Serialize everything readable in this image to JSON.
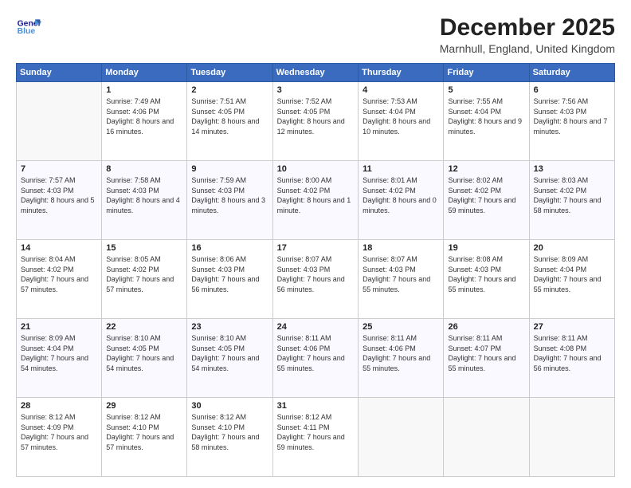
{
  "logo": {
    "line1": "General",
    "line2": "Blue"
  },
  "title": "December 2025",
  "subtitle": "Marnhull, England, United Kingdom",
  "days_header": [
    "Sunday",
    "Monday",
    "Tuesday",
    "Wednesday",
    "Thursday",
    "Friday",
    "Saturday"
  ],
  "weeks": [
    [
      {
        "num": "",
        "sunrise": "",
        "sunset": "",
        "daylight": ""
      },
      {
        "num": "1",
        "sunrise": "Sunrise: 7:49 AM",
        "sunset": "Sunset: 4:06 PM",
        "daylight": "Daylight: 8 hours and 16 minutes."
      },
      {
        "num": "2",
        "sunrise": "Sunrise: 7:51 AM",
        "sunset": "Sunset: 4:05 PM",
        "daylight": "Daylight: 8 hours and 14 minutes."
      },
      {
        "num": "3",
        "sunrise": "Sunrise: 7:52 AM",
        "sunset": "Sunset: 4:05 PM",
        "daylight": "Daylight: 8 hours and 12 minutes."
      },
      {
        "num": "4",
        "sunrise": "Sunrise: 7:53 AM",
        "sunset": "Sunset: 4:04 PM",
        "daylight": "Daylight: 8 hours and 10 minutes."
      },
      {
        "num": "5",
        "sunrise": "Sunrise: 7:55 AM",
        "sunset": "Sunset: 4:04 PM",
        "daylight": "Daylight: 8 hours and 9 minutes."
      },
      {
        "num": "6",
        "sunrise": "Sunrise: 7:56 AM",
        "sunset": "Sunset: 4:03 PM",
        "daylight": "Daylight: 8 hours and 7 minutes."
      }
    ],
    [
      {
        "num": "7",
        "sunrise": "Sunrise: 7:57 AM",
        "sunset": "Sunset: 4:03 PM",
        "daylight": "Daylight: 8 hours and 5 minutes."
      },
      {
        "num": "8",
        "sunrise": "Sunrise: 7:58 AM",
        "sunset": "Sunset: 4:03 PM",
        "daylight": "Daylight: 8 hours and 4 minutes."
      },
      {
        "num": "9",
        "sunrise": "Sunrise: 7:59 AM",
        "sunset": "Sunset: 4:03 PM",
        "daylight": "Daylight: 8 hours and 3 minutes."
      },
      {
        "num": "10",
        "sunrise": "Sunrise: 8:00 AM",
        "sunset": "Sunset: 4:02 PM",
        "daylight": "Daylight: 8 hours and 1 minute."
      },
      {
        "num": "11",
        "sunrise": "Sunrise: 8:01 AM",
        "sunset": "Sunset: 4:02 PM",
        "daylight": "Daylight: 8 hours and 0 minutes."
      },
      {
        "num": "12",
        "sunrise": "Sunrise: 8:02 AM",
        "sunset": "Sunset: 4:02 PM",
        "daylight": "Daylight: 7 hours and 59 minutes."
      },
      {
        "num": "13",
        "sunrise": "Sunrise: 8:03 AM",
        "sunset": "Sunset: 4:02 PM",
        "daylight": "Daylight: 7 hours and 58 minutes."
      }
    ],
    [
      {
        "num": "14",
        "sunrise": "Sunrise: 8:04 AM",
        "sunset": "Sunset: 4:02 PM",
        "daylight": "Daylight: 7 hours and 57 minutes."
      },
      {
        "num": "15",
        "sunrise": "Sunrise: 8:05 AM",
        "sunset": "Sunset: 4:02 PM",
        "daylight": "Daylight: 7 hours and 57 minutes."
      },
      {
        "num": "16",
        "sunrise": "Sunrise: 8:06 AM",
        "sunset": "Sunset: 4:03 PM",
        "daylight": "Daylight: 7 hours and 56 minutes."
      },
      {
        "num": "17",
        "sunrise": "Sunrise: 8:07 AM",
        "sunset": "Sunset: 4:03 PM",
        "daylight": "Daylight: 7 hours and 56 minutes."
      },
      {
        "num": "18",
        "sunrise": "Sunrise: 8:07 AM",
        "sunset": "Sunset: 4:03 PM",
        "daylight": "Daylight: 7 hours and 55 minutes."
      },
      {
        "num": "19",
        "sunrise": "Sunrise: 8:08 AM",
        "sunset": "Sunset: 4:03 PM",
        "daylight": "Daylight: 7 hours and 55 minutes."
      },
      {
        "num": "20",
        "sunrise": "Sunrise: 8:09 AM",
        "sunset": "Sunset: 4:04 PM",
        "daylight": "Daylight: 7 hours and 55 minutes."
      }
    ],
    [
      {
        "num": "21",
        "sunrise": "Sunrise: 8:09 AM",
        "sunset": "Sunset: 4:04 PM",
        "daylight": "Daylight: 7 hours and 54 minutes."
      },
      {
        "num": "22",
        "sunrise": "Sunrise: 8:10 AM",
        "sunset": "Sunset: 4:05 PM",
        "daylight": "Daylight: 7 hours and 54 minutes."
      },
      {
        "num": "23",
        "sunrise": "Sunrise: 8:10 AM",
        "sunset": "Sunset: 4:05 PM",
        "daylight": "Daylight: 7 hours and 54 minutes."
      },
      {
        "num": "24",
        "sunrise": "Sunrise: 8:11 AM",
        "sunset": "Sunset: 4:06 PM",
        "daylight": "Daylight: 7 hours and 55 minutes."
      },
      {
        "num": "25",
        "sunrise": "Sunrise: 8:11 AM",
        "sunset": "Sunset: 4:06 PM",
        "daylight": "Daylight: 7 hours and 55 minutes."
      },
      {
        "num": "26",
        "sunrise": "Sunrise: 8:11 AM",
        "sunset": "Sunset: 4:07 PM",
        "daylight": "Daylight: 7 hours and 55 minutes."
      },
      {
        "num": "27",
        "sunrise": "Sunrise: 8:11 AM",
        "sunset": "Sunset: 4:08 PM",
        "daylight": "Daylight: 7 hours and 56 minutes."
      }
    ],
    [
      {
        "num": "28",
        "sunrise": "Sunrise: 8:12 AM",
        "sunset": "Sunset: 4:09 PM",
        "daylight": "Daylight: 7 hours and 57 minutes."
      },
      {
        "num": "29",
        "sunrise": "Sunrise: 8:12 AM",
        "sunset": "Sunset: 4:10 PM",
        "daylight": "Daylight: 7 hours and 57 minutes."
      },
      {
        "num": "30",
        "sunrise": "Sunrise: 8:12 AM",
        "sunset": "Sunset: 4:10 PM",
        "daylight": "Daylight: 7 hours and 58 minutes."
      },
      {
        "num": "31",
        "sunrise": "Sunrise: 8:12 AM",
        "sunset": "Sunset: 4:11 PM",
        "daylight": "Daylight: 7 hours and 59 minutes."
      },
      {
        "num": "",
        "sunrise": "",
        "sunset": "",
        "daylight": ""
      },
      {
        "num": "",
        "sunrise": "",
        "sunset": "",
        "daylight": ""
      },
      {
        "num": "",
        "sunrise": "",
        "sunset": "",
        "daylight": ""
      }
    ]
  ]
}
